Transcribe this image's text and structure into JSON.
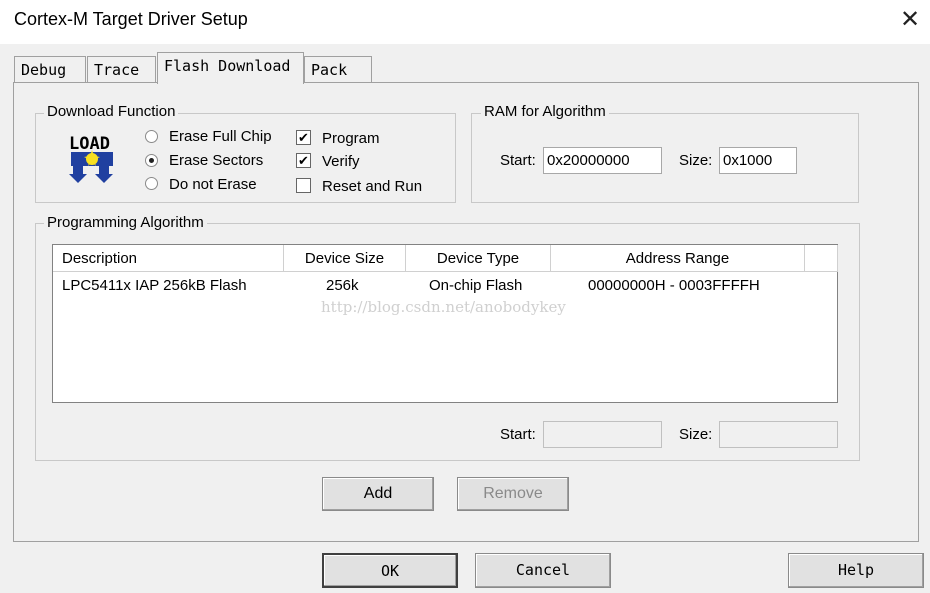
{
  "window": {
    "title": "Cortex-M Target Driver Setup"
  },
  "tabs": [
    {
      "label": "Debug",
      "active": false
    },
    {
      "label": "Trace",
      "active": false
    },
    {
      "label": "Flash Download",
      "active": true
    },
    {
      "label": "Pack",
      "active": false
    }
  ],
  "download_function": {
    "label": "Download Function",
    "icon_text": "LOAD",
    "radios": [
      {
        "label": "Erase Full Chip",
        "selected": false
      },
      {
        "label": "Erase Sectors",
        "selected": true
      },
      {
        "label": "Do not Erase",
        "selected": false
      }
    ],
    "checks": [
      {
        "label": "Program",
        "checked": true
      },
      {
        "label": "Verify",
        "checked": true
      },
      {
        "label": "Reset and Run",
        "checked": false
      }
    ]
  },
  "ram": {
    "label": "RAM for Algorithm",
    "start_label": "Start:",
    "start_value": "0x20000000",
    "size_label": "Size:",
    "size_value": "0x1000"
  },
  "programming": {
    "label": "Programming Algorithm",
    "columns": [
      "Description",
      "Device Size",
      "Device Type",
      "Address Range"
    ],
    "rows": [
      [
        "LPC5411x IAP 256kB Flash",
        "256k",
        "On-chip Flash",
        "00000000H - 0003FFFFH"
      ]
    ],
    "watermark": "http://blog.csdn.net/anobodykey",
    "start_label": "Start:",
    "start_value": "",
    "size_label": "Size:",
    "size_value": ""
  },
  "buttons": {
    "add": "Add",
    "remove": "Remove",
    "ok": "OK",
    "cancel": "Cancel",
    "help": "Help"
  },
  "icons": {
    "close": "close-icon",
    "load": "load-icon"
  }
}
